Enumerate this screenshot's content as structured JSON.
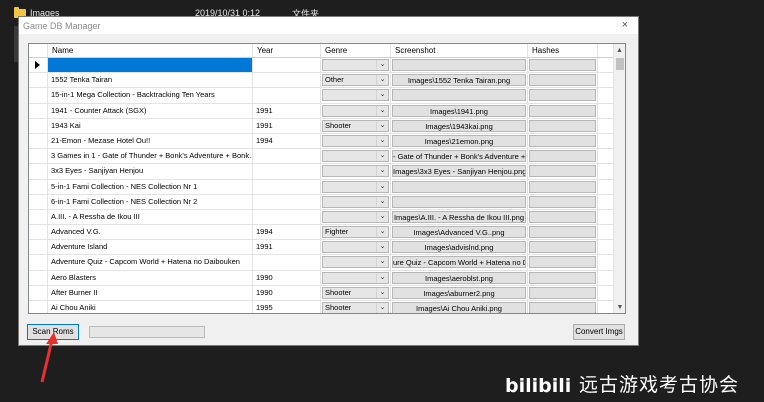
{
  "background": {
    "folder_name": "Images",
    "folder_date": "2019/10/31 0:12",
    "folder_type": "文件夹"
  },
  "window": {
    "title": "Game DB Manager",
    "close_glyph": "×"
  },
  "grid": {
    "columns": [
      "Name",
      "Year",
      "Genre",
      "Screenshot",
      "Hashes"
    ],
    "rows": [
      {
        "name": "",
        "year": "",
        "genre": "",
        "screenshot": "",
        "selected": true,
        "current": true
      },
      {
        "name": "1552 Tenka Tairan",
        "year": "",
        "genre": "Other",
        "screenshot": "Images\\1552 Tenka Tairan.png"
      },
      {
        "name": "15-in-1 Mega Collection - Backtracking Ten Years",
        "year": "",
        "genre": "",
        "screenshot": ""
      },
      {
        "name": "1941 - Counter Attack (SGX)",
        "year": "1991",
        "genre": "",
        "screenshot": "Images\\1941.png"
      },
      {
        "name": "1943 Kai",
        "year": "1991",
        "genre": "Shooter",
        "screenshot": "Images\\1943kai.png"
      },
      {
        "name": "21-Emon - Mezase Hotel Ou!!",
        "year": "1994",
        "genre": "",
        "screenshot": "Images\\21emon.png"
      },
      {
        "name": "3 Games in 1 - Gate of Thunder + Bonk's Adventure + Bonk...",
        "year": "",
        "genre": "",
        "screenshot": "- Gate of Thunder + Bonk's Adventure +"
      },
      {
        "name": "3x3 Eyes - Sanjiyan Henjou",
        "year": "",
        "genre": "",
        "screenshot": "Images\\3x3 Eyes - Sanjiyan Henjou.png"
      },
      {
        "name": "5-in-1 Fami Collection - NES Collection Nr 1",
        "year": "",
        "genre": "",
        "screenshot": ""
      },
      {
        "name": "6-in-1 Fami Collection - NES Collection Nr 2",
        "year": "",
        "genre": "",
        "screenshot": ""
      },
      {
        "name": "A.III. - A Ressha de Ikou III",
        "year": "",
        "genre": "",
        "screenshot": "Images\\A.III. - A Ressha de Ikou III.png"
      },
      {
        "name": "Advanced V.G.",
        "year": "1994",
        "genre": "Fighter",
        "screenshot": "Images\\Advanced V.G..png"
      },
      {
        "name": "Adventure Island",
        "year": "1991",
        "genre": "",
        "screenshot": "Images\\advislnd.png"
      },
      {
        "name": "Adventure Quiz - Capcom World + Hatena no Daibouken",
        "year": "",
        "genre": "",
        "screenshot": "ure Quiz - Capcom World + Hatena no D"
      },
      {
        "name": "Aero Blasters",
        "year": "1990",
        "genre": "",
        "screenshot": "Images\\aeroblst.png"
      },
      {
        "name": "After Burner II",
        "year": "1990",
        "genre": "Shooter",
        "screenshot": "Images\\aburner2.png"
      },
      {
        "name": "Ai Chou Aniki",
        "year": "1995",
        "genre": "Shooter",
        "screenshot": "Images\\Ai Chou Aniki.png"
      }
    ]
  },
  "buttons": {
    "scan": "Scan Roms",
    "convert": "Convert Imgs"
  },
  "watermark": {
    "logo_text": "bilibili",
    "text": "远古游戏考古协会"
  },
  "icons": {
    "folder": "folder-icon",
    "row_pointer": "row-pointer-icon",
    "dropdown": "chevron-down-icon",
    "scroll_up": "scroll-up-icon",
    "scroll_down": "scroll-down-icon",
    "annotation": "red-arrow-icon"
  },
  "colors": {
    "selection": "#0078d7",
    "annotation_arrow": "#e8312f",
    "background": "#1e1e1e"
  }
}
